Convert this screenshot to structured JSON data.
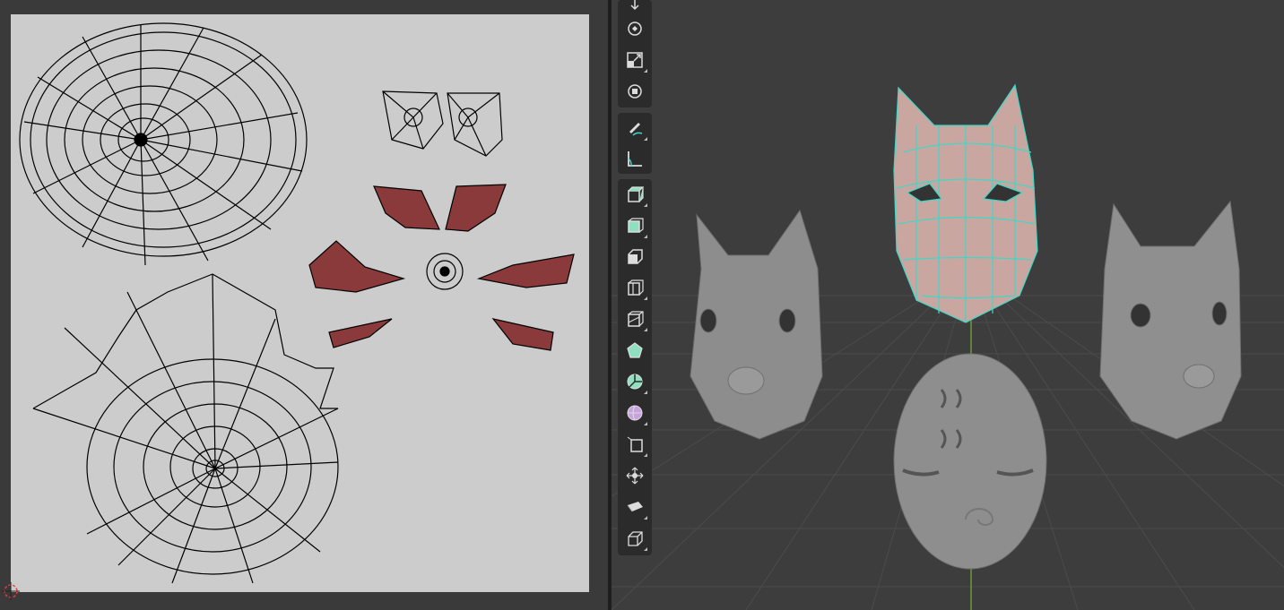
{
  "uv_editor": {
    "background": "#3a3a3a",
    "grid_color": "#cccccc",
    "wire_color": "#000000",
    "selected_face_color": "#8a3a3a"
  },
  "viewport": {
    "background": "#3d3d3d",
    "grid_color": "#4a4a4a",
    "axis_y_color": "#6c9a3a",
    "mesh_color": "#8f8f8f",
    "selection_wire_color": "#3fd8c8",
    "selected_face_color": "#c9a7a0"
  },
  "toolbar": {
    "groups": [
      [
        "move-icon",
        "rotate-icon",
        "scale-icon",
        "transform-icon"
      ],
      [
        "annotate-icon",
        "measure-icon"
      ],
      [
        "add-cube-icon",
        "extrude-region-icon",
        "inset-faces-icon",
        "bevel-icon",
        "loop-cut-icon",
        "knife-icon",
        "poly-build-icon",
        "spin-icon",
        "smooth-icon",
        "edge-slide-icon",
        "shrink-fatten-icon",
        "shear-icon",
        "rip-region-icon"
      ]
    ]
  }
}
